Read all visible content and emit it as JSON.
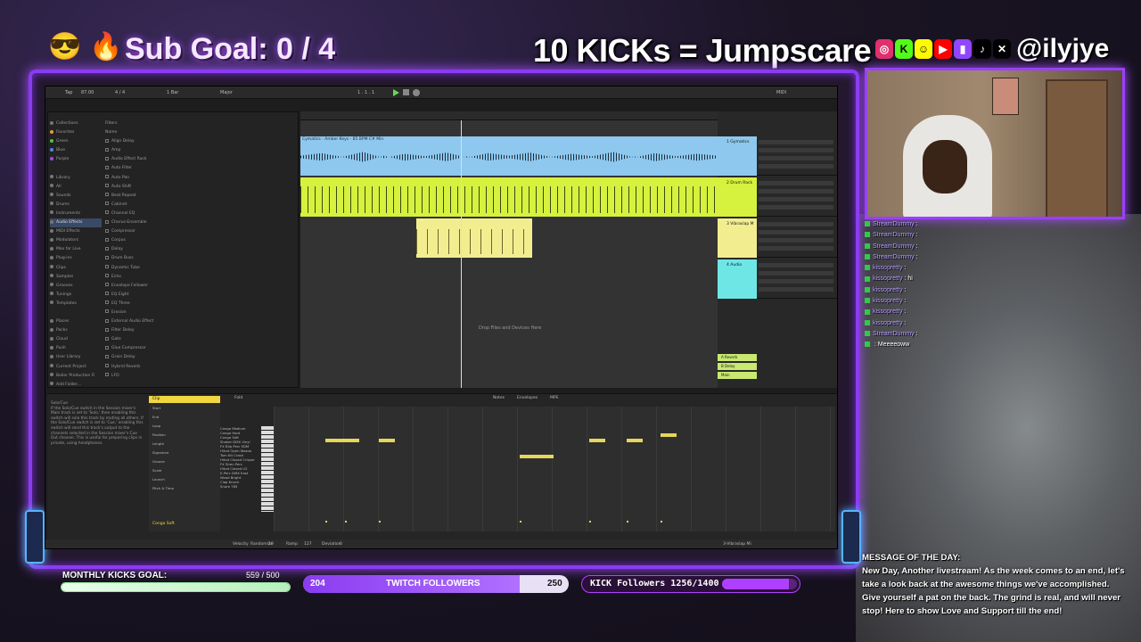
{
  "header": {
    "emojis": [
      "😎",
      "🔥"
    ],
    "sub_goal": "Sub Goal:  0 / 4",
    "kicks_title": "10 KICKs = Jumpscare",
    "handle": "@ilyjye",
    "social_icons": [
      "instagram-icon",
      "kick-icon",
      "snapchat-icon",
      "youtube-icon",
      "twitch-icon",
      "tiktok-icon",
      "x-icon"
    ]
  },
  "daw": {
    "top_bar": {
      "tempo": "87.00",
      "signature": "4 / 4",
      "bar": "1 Bar",
      "key": "Major",
      "position": "1 . 1 . 1",
      "cpu": "MIDI"
    },
    "browser": {
      "categories": [
        "Collections",
        "Favorites",
        "Green",
        "Blue",
        "Purple",
        "",
        "Library",
        "All",
        "Sounds",
        "Drums",
        "Instruments",
        "Audio Effects",
        "MIDI Effects",
        "Modulators",
        "Max for Live",
        "Plug-ins",
        "Clips",
        "Samples",
        "Grooves",
        "Tunings",
        "Templates",
        "",
        "Places",
        "Packs",
        "Cloud",
        "Push",
        "User Library",
        "Current Project",
        "Boiler Production Fi",
        "Add Folder..."
      ],
      "filters_label": "Filters",
      "name_header": "Name",
      "items": [
        "Align Delay",
        "Amp",
        "Audio Effect Rack",
        "Auto Filter",
        "Auto Pan",
        "Auto Shift",
        "Beat Repeat",
        "Cabinet",
        "Channel EQ",
        "Chorus-Ensemble",
        "Compressor",
        "Corpus",
        "Delay",
        "Drum Buss",
        "Dynamic Tube",
        "Echo",
        "Envelope Follower",
        "EQ Eight",
        "EQ Three",
        "Erosion",
        "External Audio Effect",
        "Filter Delay",
        "Gate",
        "Glue Compressor",
        "Grain Delay",
        "Hybrid Reverb",
        "LFO"
      ]
    },
    "tracks": [
      {
        "name": "1 Gymatics",
        "clip": "Cymatics - Amber Keys - 85 BPM C# Min",
        "color": "#8ec8ee"
      },
      {
        "name": "2 Drum Rack",
        "clip": "",
        "color": "#d6f13e"
      },
      {
        "name": "3 Vibraslap M",
        "clip": "",
        "color": "#f2ee90"
      },
      {
        "name": "4 Audio",
        "clip": "",
        "color": "#6ee6e6"
      }
    ],
    "drop_text": "Drop Files and Devices Here",
    "returns": [
      "A Reverb",
      "B Delay",
      "Main"
    ],
    "info_title": "Solo/Cue",
    "info_text": "If the Solo/Cue switch in the Session mixer's Main track is set to 'Solo,' then enabling this switch will solo this track by muting all others. If the Solo/Cue switch is set to 'Cue,' enabling this switch will send this track's output to the channels selected in the Session mixer's Cue Out chooser. This is useful for preparing clips in private, using headphones.",
    "clip_panel": {
      "title": "Clip",
      "name": "Conga Soft",
      "labels": [
        "Start",
        "End",
        "Loop",
        "Position",
        "Length",
        "Signature",
        "Groove",
        "Scale",
        "Launch",
        "Pitch & Time"
      ]
    },
    "piano_rows": [
      "Conga Medium",
      "Conga Hard",
      "Conga Soft",
      "Shaker DMX Vinyl",
      "FX Blip Perc EDM",
      "Hihat Open Wazoo",
      "Tom Kit Crash",
      "Hihat Closed Crisper",
      "FX Siren Perc",
      "Hihat Closed U2",
      "E-Perc DMX East",
      "Wood Bright",
      "Clap Knock",
      "Snare 785"
    ],
    "bottom_tabs": [
      "Notes",
      "Envelopes",
      "MPE"
    ],
    "fold_label": "Fold",
    "status": [
      "Velocity",
      "Randomize",
      "10",
      "Ramp",
      "127",
      "Deviation",
      "0"
    ],
    "track_label": "3-Vibraslap Mi"
  },
  "widgets": {
    "monthly_kicks_label": "MONTHLY KICKS GOAL:",
    "monthly_kicks_value": "559 / 500",
    "monthly_kicks_progress": 1.0,
    "twitch_left": "204",
    "twitch_label": "TWITCH FOLLOWERS",
    "twitch_right": "250",
    "twitch_progress": 0.816,
    "kick_followers": "KICK Followers 1256/1400",
    "kick_progress": 0.897
  },
  "chat": [
    {
      "user": "StreamDummy",
      "msg": ""
    },
    {
      "user": "StreamDummy",
      "msg": ""
    },
    {
      "user": "StreamDummy",
      "msg": ""
    },
    {
      "user": "StreamDummy",
      "msg": ""
    },
    {
      "user": "kissopretty",
      "msg": ""
    },
    {
      "user": "kissopretty",
      "msg": "hi"
    },
    {
      "user": "kissopretty",
      "msg": ""
    },
    {
      "user": "kissopretty",
      "msg": ""
    },
    {
      "user": "kissopretty",
      "msg": ""
    },
    {
      "user": "kissopretty",
      "msg": ""
    },
    {
      "user": "StreamDummy",
      "msg": ""
    },
    {
      "user": "",
      "msg": "Meeeeoww"
    }
  ],
  "motd": {
    "title": "MESSAGE OF THE DAY:",
    "body": "New Day, Another livestream! As the week comes to an end, let's take a look back at the awesome things we've accomplished. Give yourself a pat on the back. The grind is real, and will never stop! Here to show Love and Support till the end!"
  }
}
